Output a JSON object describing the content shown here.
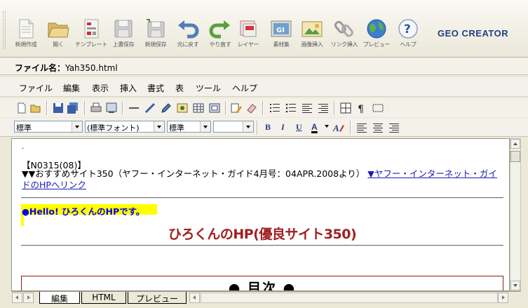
{
  "toolbar": {
    "buttons": [
      {
        "label": "新規作成",
        "icon": "new-document-icon"
      },
      {
        "label": "開く",
        "icon": "open-folder-icon"
      },
      {
        "label": "テンプレート",
        "icon": "template-icon"
      },
      {
        "label": "上書保存",
        "icon": "save-icon"
      },
      {
        "label": "新規保存",
        "icon": "save-as-icon"
      },
      {
        "label": "元に戻す",
        "icon": "undo-icon"
      },
      {
        "label": "やり直す",
        "icon": "redo-icon"
      },
      {
        "label": "レイヤー",
        "icon": "layer-icon"
      },
      {
        "label": "素材集",
        "icon": "material-icon"
      },
      {
        "label": "画像挿入",
        "icon": "insert-image-icon"
      },
      {
        "label": "リンク挿入",
        "icon": "insert-link-icon"
      },
      {
        "label": "プレビュー",
        "icon": "preview-globe-icon"
      },
      {
        "label": "ヘルプ",
        "icon": "help-icon"
      }
    ],
    "brand": "GEO CREATOR"
  },
  "file": {
    "label": "ファイル名：",
    "name": "Yah350.html"
  },
  "menu": [
    "ファイル",
    "編集",
    "表示",
    "挿入",
    "書式",
    "表",
    "ツール",
    "ヘルプ"
  ],
  "format": {
    "paragraph": "標準",
    "font": "(標準フォント)",
    "size": "標準",
    "color": "",
    "bold": "B",
    "italic": "I",
    "underline": "U",
    "fontcolor": "A"
  },
  "document": {
    "dot": ".",
    "code": "【N0315(08)】",
    "intro": "▼▼おすすめサイト350（ヤフー・インターネット・ガイド4月号：04APR.2008より）",
    "link": "▼ヤフー・インターネット・ガイドのHPへリンク",
    "hello": "●Hello! ひろくんのHPです。",
    "site_title": "ひろくんのHP(優良サイト350)",
    "toc": "● 目次 ●"
  },
  "tabs": [
    "編集",
    "HTML",
    "プレビュー"
  ],
  "colors": {
    "link": "#1a1ab6",
    "highlight": "#ffff00",
    "title": "#a02020",
    "brand": "#233e83"
  }
}
